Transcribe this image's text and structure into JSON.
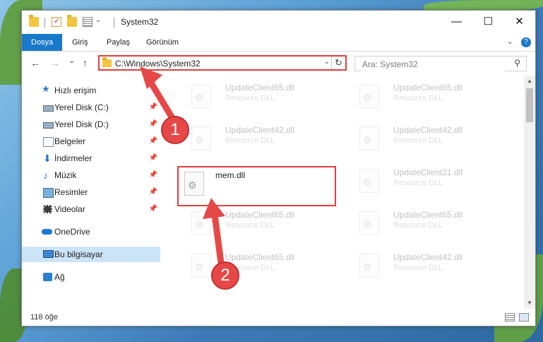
{
  "window": {
    "title": "System32",
    "minimize_glyph": "—",
    "maximize_glyph": "☐",
    "close_glyph": "✕"
  },
  "ribbon": {
    "tabs": [
      {
        "label": "Dosya",
        "active": true
      },
      {
        "label": "Giriş"
      },
      {
        "label": "Paylaş"
      },
      {
        "label": "Görünüm"
      }
    ],
    "collapse_glyph": "⌄",
    "help_glyph": "?"
  },
  "address_bar": {
    "path": "C:\\Windows\\System32",
    "refresh_glyph": "↻",
    "dropdown_glyph": "⌄"
  },
  "search": {
    "placeholder": "Ara: System32"
  },
  "nav": {
    "back": "←",
    "forward": "→",
    "recent": "⌄",
    "up": "↑"
  },
  "sidebar": {
    "items": [
      {
        "label": "Hızlı erişim",
        "icon": "star-icon"
      },
      {
        "label": "Yerel Disk (C:)",
        "icon": "drive-icon",
        "pinned": true
      },
      {
        "label": "Yerel Disk (D:)",
        "icon": "drive-icon",
        "pinned": true
      },
      {
        "label": "Belgeler",
        "icon": "documents-icon",
        "pinned": true
      },
      {
        "label": "İndirmeler",
        "icon": "download-icon",
        "pinned": true
      },
      {
        "label": "Müzik",
        "icon": "music-icon",
        "pinned": true
      },
      {
        "label": "Resimler",
        "icon": "pictures-icon",
        "pinned": true
      },
      {
        "label": "Videolar",
        "icon": "video-icon",
        "pinned": true
      },
      {
        "label": "OneDrive",
        "icon": "onedrive-icon"
      },
      {
        "label": "Bu bilgisayar",
        "icon": "computer-icon",
        "selected": true
      },
      {
        "label": "Ağ",
        "icon": "network-icon"
      }
    ],
    "pin_glyph": "📌"
  },
  "files": {
    "left_column": [
      {
        "name": "UpdateClient65.dll",
        "desc": "Resource DLL",
        "faded": true
      },
      {
        "name": "UpdateClient42.dll",
        "desc": "Resource DLL",
        "faded": true
      },
      {
        "name": "mem.dll",
        "desc": "",
        "faded": false,
        "highlighted": true
      },
      {
        "name": "UpdateClient65.dll",
        "desc": "Resource DLL",
        "faded": true
      },
      {
        "name": "UpdateClient65.dll",
        "desc": "Resource DLL",
        "faded": true
      }
    ],
    "right_column": [
      {
        "name": "UpdateClient65.dll",
        "desc": "Resource DLL",
        "faded": true
      },
      {
        "name": "UpdateClient42.dll",
        "desc": "Resource DLL",
        "faded": true
      },
      {
        "name": "UpdateClient21.dll",
        "desc": "Resource DLL",
        "faded": true
      },
      {
        "name": "UpdateClient65.dll",
        "desc": "Resource DLL",
        "faded": true
      },
      {
        "name": "UpdateClient42.dll",
        "desc": "Resource DLL",
        "faded": true
      }
    ]
  },
  "status": {
    "item_count": "118 öğe"
  },
  "callouts": [
    {
      "number": "1"
    },
    {
      "number": "2"
    }
  ],
  "colors": {
    "accent": "#1979ca",
    "callout": "#e64848",
    "highlight_border": "#e03e3e",
    "selection": "#cce4f7"
  }
}
